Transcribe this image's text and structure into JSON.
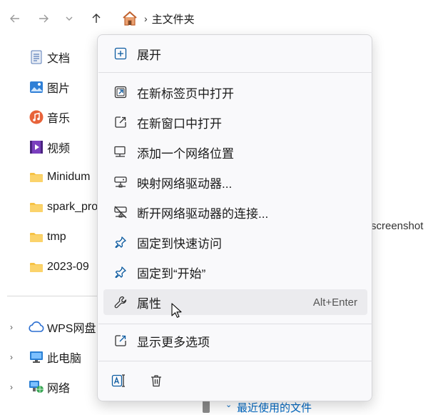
{
  "address_bar": {
    "crumb": "主文件夹",
    "separator": "›"
  },
  "sidebar": {
    "items": [
      {
        "label": "文档"
      },
      {
        "label": "图片"
      },
      {
        "label": "音乐"
      },
      {
        "label": "视频"
      },
      {
        "label": "Minidum"
      },
      {
        "label": "spark_pro"
      },
      {
        "label": "tmp"
      },
      {
        "label": "2023-09"
      }
    ],
    "tree": [
      {
        "label": "WPS网盘"
      },
      {
        "label": "此电脑"
      },
      {
        "label": "网络"
      }
    ],
    "chevron": "›"
  },
  "content": {
    "partial_text": "screenshot",
    "recent_chevron": "⌄",
    "recent_label": "最近使用的文件"
  },
  "context_menu": {
    "expand": "展开",
    "open_new_tab": "在新标签页中打开",
    "open_new_window": "在新窗口中打开",
    "add_network_location": "添加一个网络位置",
    "map_network_drive": "映射网络驱动器...",
    "disconnect_network_drive": "断开网络驱动器的连接...",
    "pin_quick_access": "固定到快速访问",
    "pin_start": "固定到“开始”",
    "properties": "属性",
    "properties_shortcut": "Alt+Enter",
    "show_more_options": "显示更多选项"
  },
  "colors": {
    "accent": "#0067c0",
    "folder": "#f6c244",
    "menu_bg": "#f9f9fb",
    "hover": "#ebebee"
  }
}
